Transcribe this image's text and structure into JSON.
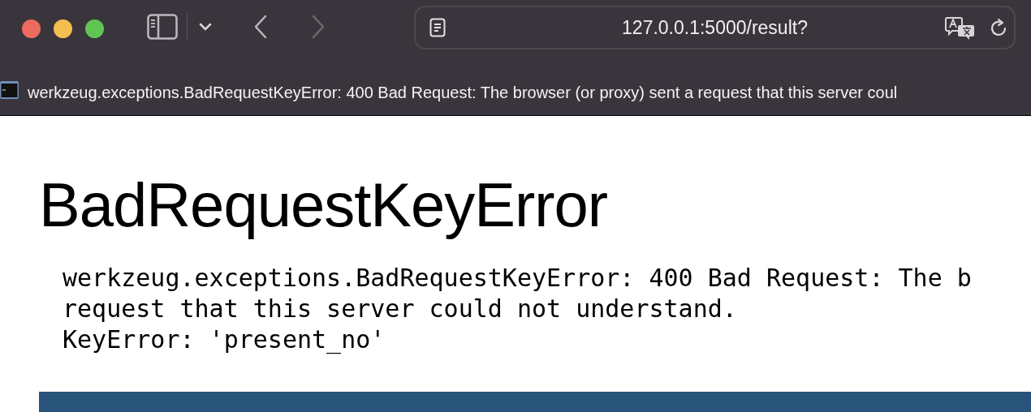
{
  "browser": {
    "address": "127.0.0.1:5000/result?",
    "tab_title": "werkzeug.exceptions.BadRequestKeyError: 400 Bad Request: The browser (or proxy) sent a request that this server coul"
  },
  "page": {
    "heading": "BadRequestKeyError",
    "message_lines": [
      "werkzeug.exceptions.BadRequestKeyError: 400 Bad Request: The b",
      "request that this server could not understand.",
      "KeyError: 'present_no'"
    ]
  }
}
